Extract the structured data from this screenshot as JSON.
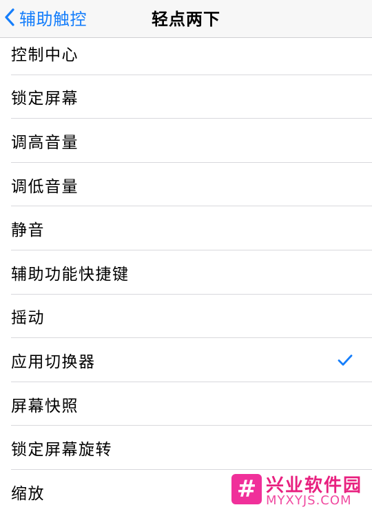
{
  "nav": {
    "back_label": "辅助触控",
    "title": "轻点两下"
  },
  "items": [
    {
      "label": "控制中心",
      "checked": false
    },
    {
      "label": "锁定屏幕",
      "checked": false
    },
    {
      "label": "调高音量",
      "checked": false
    },
    {
      "label": "调低音量",
      "checked": false
    },
    {
      "label": "静音",
      "checked": false
    },
    {
      "label": "辅助功能快捷键",
      "checked": false
    },
    {
      "label": "摇动",
      "checked": false
    },
    {
      "label": "应用切换器",
      "checked": true
    },
    {
      "label": "屏幕快照",
      "checked": false
    },
    {
      "label": "锁定屏幕旋转",
      "checked": false
    },
    {
      "label": "缩放",
      "checked": false
    }
  ],
  "watermark": {
    "logo_glyph": "#",
    "name": "兴业软件园",
    "url": "MYXYJS.COM"
  },
  "colors": {
    "accent": "#157efb",
    "watermark": "#e8207f"
  },
  "icons": {
    "back": "chevron-left-icon",
    "check": "checkmark-icon"
  }
}
